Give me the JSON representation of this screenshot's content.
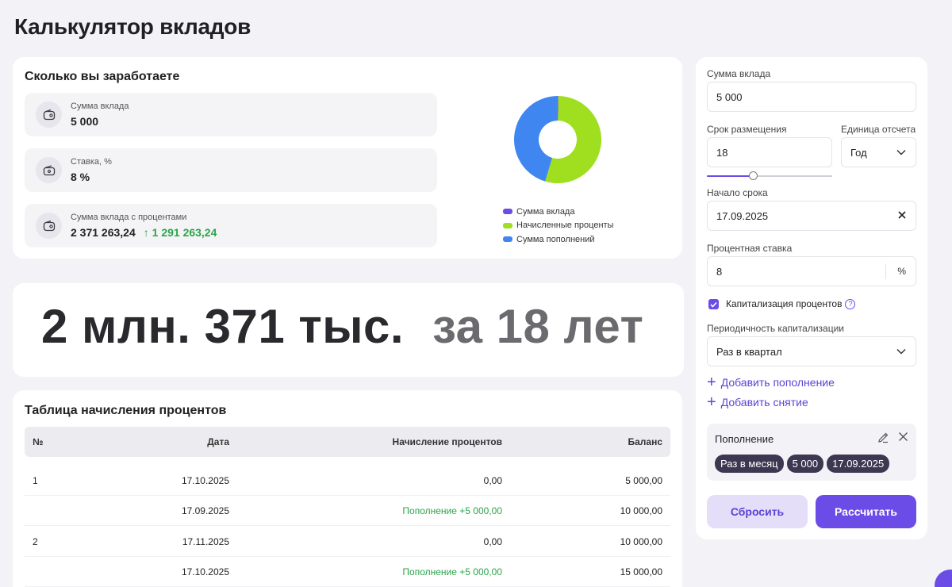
{
  "page_title": "Калькулятор вкладов",
  "summary": {
    "title": "Сколько вы заработаете",
    "stats": [
      {
        "label": "Сумма вклада",
        "value": "5 000",
        "icon": "wallet-icon"
      },
      {
        "label": "Ставка, %",
        "value": "8 %",
        "icon": "percent-wallet-icon"
      },
      {
        "label": "Сумма вклада с процентами",
        "value": "2 371 263,24",
        "delta": "↑ 1 291 263,24",
        "icon": "wallet-icon"
      }
    ],
    "legend": [
      {
        "label": "Сумма вклада",
        "color": "#6b4ce6"
      },
      {
        "label": "Начисленные проценты",
        "color": "#9fdf1f"
      },
      {
        "label": "Сумма пополнений",
        "color": "#3f86f0"
      }
    ]
  },
  "chart_data": {
    "type": "pie",
    "categories": [
      "Сумма вклада",
      "Начисленные проценты",
      "Сумма пополнений"
    ],
    "values": [
      5000,
      1291263.24,
      1075000
    ],
    "colors": [
      "#6b4ce6",
      "#9fdf1f",
      "#3f86f0"
    ]
  },
  "banner": {
    "amount": "2 млн. 371 тыс.",
    "period": "за 18 лет"
  },
  "table": {
    "title": "Таблица начисления процентов",
    "columns": [
      "№",
      "Дата",
      "Начисление процентов",
      "Баланс"
    ],
    "rows": [
      {
        "num": "1",
        "date": "17.10.2025",
        "accrual": "0,00",
        "balance": "5 000,00",
        "highlight": false
      },
      {
        "num": "",
        "date": "17.09.2025",
        "accrual": "Пополнение +5 000,00",
        "balance": "10 000,00",
        "highlight": true
      },
      {
        "num": "2",
        "date": "17.11.2025",
        "accrual": "0,00",
        "balance": "10 000,00",
        "highlight": false
      },
      {
        "num": "",
        "date": "17.10.2025",
        "accrual": "Пополнение +5 000,00",
        "balance": "15 000,00",
        "highlight": true
      }
    ]
  },
  "form": {
    "deposit_label": "Сумма вклада",
    "deposit_value": "5 000",
    "term_label": "Срок размещения",
    "term_value": "18",
    "unit_label": "Единица отсчета",
    "unit_value": "Год",
    "term_slider_fraction": 0.37,
    "start_label": "Начало срока",
    "start_value": "17.09.2025",
    "rate_label": "Процентная ставка",
    "rate_value": "8",
    "rate_suffix": "%",
    "capitalization_label": "Капитализация процентов",
    "capitalization_checked": true,
    "periodicity_label": "Периодичность капитализации",
    "periodicity_value": "Раз в квартал",
    "add_topup": "Добавить пополнение",
    "add_withdrawal": "Добавить снятие",
    "topup": {
      "title": "Пополнение",
      "chips": [
        "Раз в месяц",
        "5 000",
        "17.09.2025"
      ]
    },
    "reset_label": "Сбросить",
    "calc_label": "Рассчитать"
  }
}
